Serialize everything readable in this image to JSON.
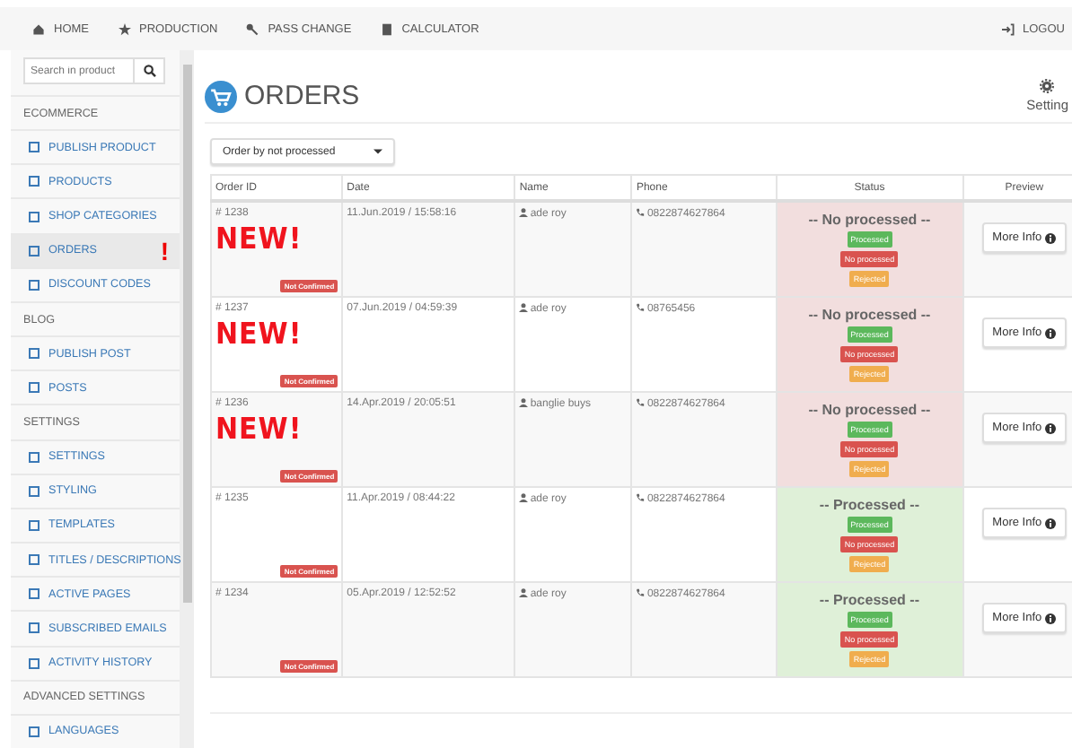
{
  "nav": {
    "items": [
      {
        "label": "HOME"
      },
      {
        "label": "PRODUCTION"
      },
      {
        "label": "PASS CHANGE"
      },
      {
        "label": "CALCULATOR"
      }
    ],
    "logout": "LOGOU"
  },
  "sidebar": {
    "search_placeholder": "Search in product",
    "items": [
      {
        "kind": "header",
        "label": "ECOMMERCE"
      },
      {
        "kind": "link",
        "label": "PUBLISH PRODUCT",
        "selected": false
      },
      {
        "kind": "link",
        "label": "PRODUCTS",
        "selected": false
      },
      {
        "kind": "link",
        "label": "SHOP CATEGORIES",
        "selected": false
      },
      {
        "kind": "link",
        "label": "ORDERS",
        "selected": true,
        "alert": "!"
      },
      {
        "kind": "link",
        "label": "DISCOUNT CODES",
        "selected": false
      },
      {
        "kind": "header",
        "label": "BLOG"
      },
      {
        "kind": "link",
        "label": "PUBLISH POST",
        "selected": false
      },
      {
        "kind": "link",
        "label": "POSTS",
        "selected": false
      },
      {
        "kind": "header",
        "label": "SETTINGS"
      },
      {
        "kind": "link",
        "label": "SETTINGS",
        "selected": false
      },
      {
        "kind": "link",
        "label": "STYLING",
        "selected": false
      },
      {
        "kind": "link",
        "label": "TEMPLATES",
        "selected": false
      },
      {
        "kind": "link",
        "label": "TITLES / DESCRIPTIONS",
        "selected": false
      },
      {
        "kind": "link",
        "label": "ACTIVE PAGES",
        "selected": false
      },
      {
        "kind": "link",
        "label": "SUBSCRIBED EMAILS",
        "selected": false
      },
      {
        "kind": "link",
        "label": "ACTIVITY HISTORY",
        "selected": false
      },
      {
        "kind": "header",
        "label": "ADVANCED SETTINGS"
      },
      {
        "kind": "link",
        "label": "LANGUAGES",
        "selected": false
      }
    ]
  },
  "page": {
    "title": "ORDERS",
    "settings_label": "Setting",
    "sort": "Order by not processed"
  },
  "table": {
    "columns": [
      "Order ID",
      "Date",
      "Name",
      "Phone",
      "Status",
      "Preview"
    ],
    "rows": [
      {
        "id": "# 1238",
        "new": true,
        "new_label": "NEW!",
        "confirm": "Not Confirmed",
        "date": "11.Jun.2019 / 15:58:16",
        "name": "ade roy",
        "phone": "0822874627864",
        "processed": false,
        "status_label": "-- No processed --",
        "actions": [
          "Processed",
          "No processed",
          "Rejected"
        ],
        "preview": "More Info"
      },
      {
        "id": "# 1237",
        "new": true,
        "new_label": "NEW!",
        "confirm": "Not Confirmed",
        "date": "07.Jun.2019 / 04:59:39",
        "name": "ade roy",
        "phone": "08765456",
        "processed": false,
        "status_label": "-- No processed --",
        "actions": [
          "Processed",
          "No processed",
          "Rejected"
        ],
        "preview": "More Info"
      },
      {
        "id": "# 1236",
        "new": true,
        "new_label": "NEW!",
        "confirm": "Not Confirmed",
        "date": "14.Apr.2019 / 20:05:51",
        "name": "banglie buys",
        "phone": "0822874627864",
        "processed": false,
        "status_label": "-- No processed --",
        "actions": [
          "Processed",
          "No processed",
          "Rejected"
        ],
        "preview": "More Info"
      },
      {
        "id": "# 1235",
        "new": false,
        "confirm": "Not Confirmed",
        "date": "11.Apr.2019 / 08:44:22",
        "name": "ade roy",
        "phone": "0822874627864",
        "processed": true,
        "status_label": "-- Processed --",
        "actions": [
          "Processed",
          "No processed",
          "Rejected"
        ],
        "preview": "More Info"
      },
      {
        "id": "# 1234",
        "new": false,
        "confirm": "Not Confirmed",
        "date": "05.Apr.2019 / 12:52:52",
        "name": "ade roy",
        "phone": "0822874627864",
        "processed": true,
        "status_label": "-- Processed --",
        "actions": [
          "Processed",
          "No processed",
          "Rejected"
        ],
        "preview": "More Info"
      }
    ]
  }
}
